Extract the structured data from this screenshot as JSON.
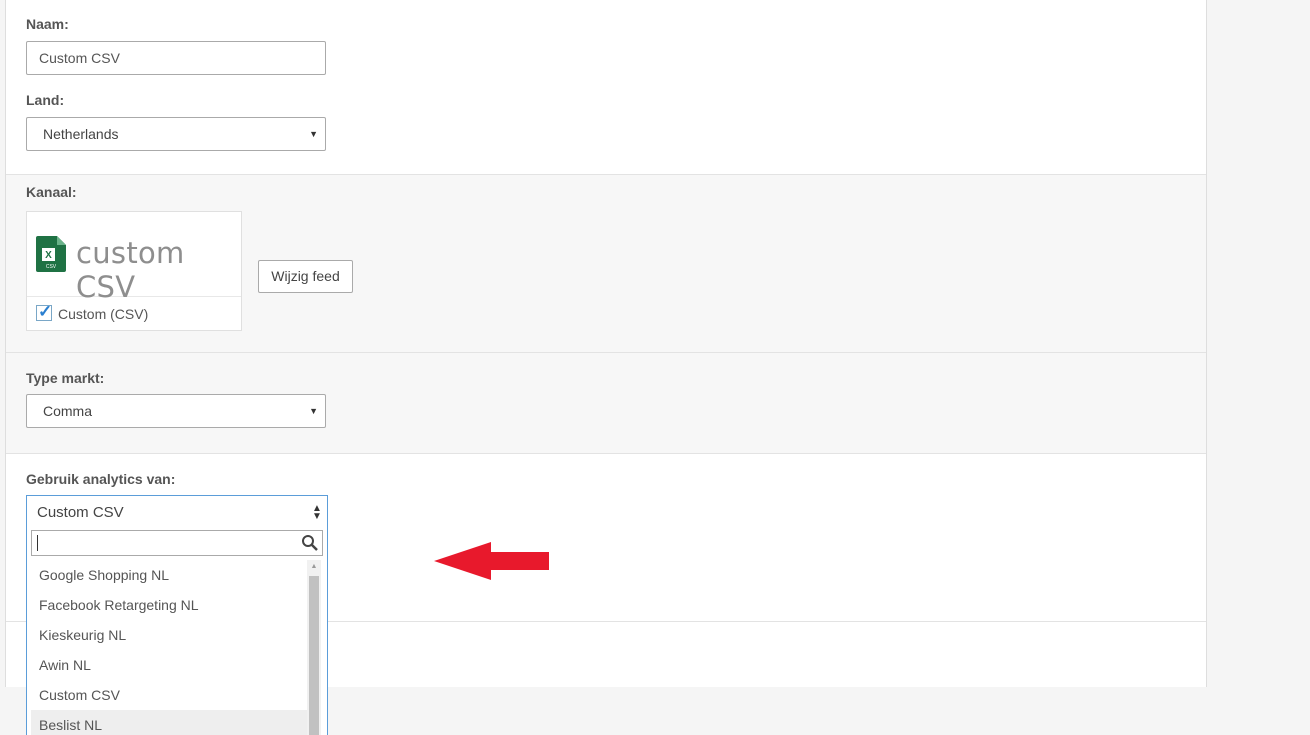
{
  "form": {
    "name": {
      "label": "Naam:",
      "value": "Custom CSV"
    },
    "country": {
      "label": "Land:",
      "value": "Netherlands"
    },
    "channel": {
      "label": "Kanaal:",
      "logo_text": "custom CSV",
      "logo_icon": "excel-csv-icon",
      "checkbox_label": "Custom (CSV)",
      "checked": true,
      "change_button": "Wijzig feed"
    },
    "market_type": {
      "label": "Type markt:",
      "value": "Comma"
    },
    "analytics": {
      "label": "Gebruik analytics van:",
      "selected": "Custom CSV",
      "search_value": "",
      "options": [
        {
          "label": "Google Shopping NL"
        },
        {
          "label": "Facebook Retargeting NL"
        },
        {
          "label": "Kieskeurig NL"
        },
        {
          "label": "Awin NL"
        },
        {
          "label": "Custom CSV"
        },
        {
          "label": "Beslist NL"
        }
      ],
      "highlighted_option": "Beslist NL"
    }
  },
  "colors": {
    "annotation_arrow": "#e8192c",
    "focus_border": "#5b9dd9",
    "excel_green": "#1f7244"
  }
}
